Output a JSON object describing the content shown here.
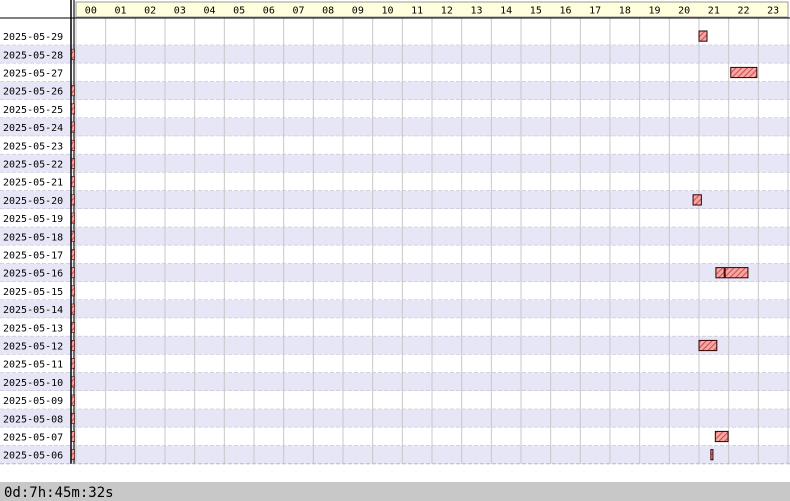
{
  "chart_data": {
    "type": "gantt",
    "x": {
      "unit": "hour",
      "range": [
        0,
        24
      ],
      "tick_labels": [
        "00",
        "01",
        "02",
        "03",
        "04",
        "05",
        "06",
        "07",
        "08",
        "09",
        "10",
        "11",
        "12",
        "13",
        "14",
        "15",
        "16",
        "17",
        "18",
        "19",
        "20",
        "21",
        "22",
        "23"
      ]
    },
    "days": [
      "2025-05-29",
      "2025-05-28",
      "2025-05-27",
      "2025-05-26",
      "2025-05-25",
      "2025-05-24",
      "2025-05-23",
      "2025-05-22",
      "2025-05-21",
      "2025-05-20",
      "2025-05-19",
      "2025-05-18",
      "2025-05-17",
      "2025-05-16",
      "2025-05-15",
      "2025-05-14",
      "2025-05-13",
      "2025-05-12",
      "2025-05-11",
      "2025-05-10",
      "2025-05-09",
      "2025-05-08",
      "2025-05-07",
      "2025-05-06"
    ],
    "events": [
      {
        "day": "2025-05-29",
        "start": 21.0,
        "end": 21.27
      },
      {
        "day": "2025-05-27",
        "start": 22.07,
        "end": 22.95
      },
      {
        "day": "2025-05-20",
        "start": 20.8,
        "end": 21.08
      },
      {
        "day": "2025-05-16",
        "start": 21.57,
        "end": 21.85
      },
      {
        "day": "2025-05-16",
        "start": 21.88,
        "end": 22.65
      },
      {
        "day": "2025-05-12",
        "start": 21.0,
        "end": 21.6
      },
      {
        "day": "2025-05-07",
        "start": 21.55,
        "end": 21.98
      },
      {
        "day": "2025-05-06",
        "start": 21.4,
        "end": 21.47
      }
    ],
    "day_edge_marks": [
      "2025-05-28",
      "2025-05-26",
      "2025-05-25",
      "2025-05-24",
      "2025-05-23",
      "2025-05-22",
      "2025-05-21",
      "2025-05-20",
      "2025-05-19",
      "2025-05-18",
      "2025-05-17",
      "2025-05-16",
      "2025-05-15",
      "2025-05-14",
      "2025-05-13",
      "2025-05-12",
      "2025-05-11",
      "2025-05-10",
      "2025-05-09",
      "2025-05-08",
      "2025-05-07",
      "2025-05-06"
    ],
    "total_label": "0d:7h:45m:32s",
    "colors": {
      "bar_fill": "#f4a6a6",
      "bar_stroke": "#330000",
      "hatch": "#c0392b",
      "row_alt": "#e6e6f6",
      "header_bg": "#ffffdd",
      "footer_bg": "#c8c8c8"
    },
    "grid": true
  }
}
